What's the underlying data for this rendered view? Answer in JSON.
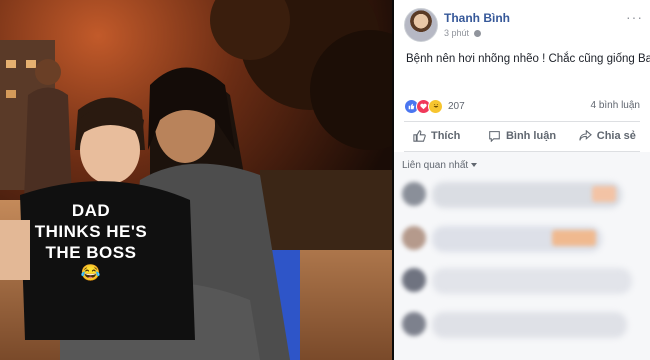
{
  "post": {
    "author": "Thanh Bình",
    "timestamp": "3 phút",
    "text": "Bệnh nên hơi nhõng nhẽo ! Chắc cũng giống Ba",
    "menu": "···"
  },
  "photo": {
    "shirt_lines": [
      "DAD",
      "THINKS HE'S",
      "THE BOSS"
    ],
    "shirt_emoji": "😂"
  },
  "reactions": {
    "count": "207",
    "comments": "4 bình luận",
    "icons": [
      "like-icon",
      "love-icon",
      "haha-icon"
    ]
  },
  "actions": {
    "like": "Thích",
    "comment": "Bình luận",
    "share": "Chia sẻ"
  },
  "comments": {
    "sort_label": "Liên quan nhất"
  },
  "colors": {
    "author": "#365899",
    "like": "#4a76f0",
    "love": "#f0395a",
    "haha": "#f7c52f",
    "panel_bg": "#f6f7f9"
  }
}
